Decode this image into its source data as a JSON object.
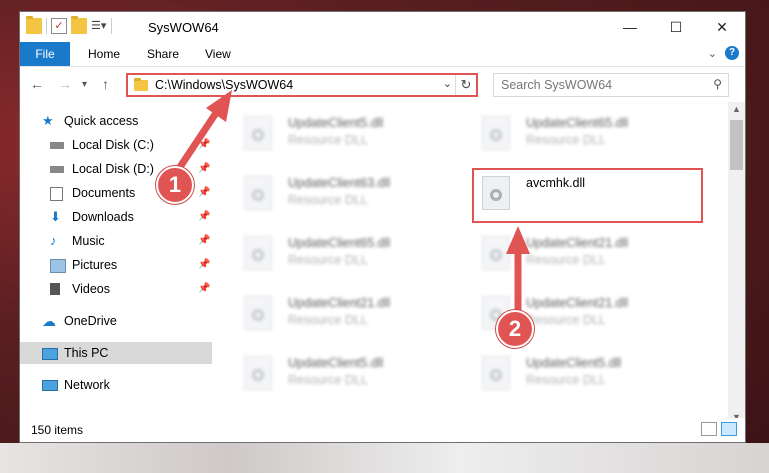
{
  "window": {
    "title": "SysWOW64"
  },
  "title_controls": {
    "minimize": "—",
    "maximize": "☐",
    "close": "✕"
  },
  "ribbon": {
    "tabs": [
      "File",
      "Home",
      "Share",
      "View"
    ]
  },
  "address": {
    "path": "C:\\Windows\\SysWOW64"
  },
  "search": {
    "placeholder": "Search SysWOW64"
  },
  "sidebar": {
    "items": [
      {
        "label": "Quick access",
        "icon": "star-icon"
      },
      {
        "label": "Local Disk (C:)",
        "icon": "drive-icon",
        "pinned": true
      },
      {
        "label": "Local Disk (D:)",
        "icon": "drive-icon",
        "pinned": true
      },
      {
        "label": "Documents",
        "icon": "documents-icon",
        "pinned": true
      },
      {
        "label": "Downloads",
        "icon": "download-icon",
        "pinned": true
      },
      {
        "label": "Music",
        "icon": "music-icon",
        "pinned": true
      },
      {
        "label": "Pictures",
        "icon": "pictures-icon",
        "pinned": true
      },
      {
        "label": "Videos",
        "icon": "videos-icon",
        "pinned": true
      },
      {
        "label": "OneDrive",
        "icon": "cloud-icon"
      },
      {
        "label": "This PC",
        "icon": "computer-icon",
        "selected": true
      },
      {
        "label": "Network",
        "icon": "network-icon"
      }
    ]
  },
  "files": [
    {
      "name": "UpdateClient5.dll",
      "type": "Resource DLL"
    },
    {
      "name": "UpdateClient65.dll",
      "type": "Resource DLL"
    },
    {
      "name": "UpdateClient63.dll",
      "type": "Resource DLL"
    },
    {
      "name": "avcmhk.dll",
      "type": ""
    },
    {
      "name": "UpdateClient65.dll",
      "type": "Resource DLL"
    },
    {
      "name": "UpdateClient21.dll",
      "type": "Resource DLL"
    },
    {
      "name": "UpdateClient21.dll",
      "type": "Resource DLL"
    },
    {
      "name": "UpdateClient21.dll",
      "type": "Resource DLL"
    },
    {
      "name": "UpdateClient5.dll",
      "type": "Resource DLL"
    },
    {
      "name": "UpdateClient5.dll",
      "type": "Resource DLL"
    }
  ],
  "status": {
    "count": "150 items"
  },
  "annotations": {
    "step1": "1",
    "step2": "2"
  },
  "colors": {
    "accent": "#1979ca",
    "highlight": "#e05554"
  }
}
